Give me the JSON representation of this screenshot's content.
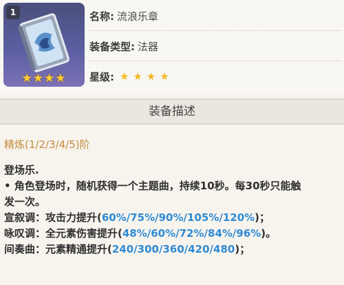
{
  "item": {
    "rarity_badge": "1",
    "stars_display": "★★★★",
    "name_label": "名称:",
    "name_value": "流浪乐章",
    "type_label": "装备类型:",
    "type_value": "法器",
    "level_label": "星级:",
    "level_value": "★★★★"
  },
  "section": {
    "title": "装备描述"
  },
  "refine": {
    "label": "精炼(1/2/3/4/5)阶"
  },
  "description": {
    "title": "登场乐.",
    "bullet_line1": "• 角色登场时，随机获得一个主题曲，持续10秒。每30秒只能触",
    "bullet_line2": "发一次。",
    "line1_prefix": "宣叙调：攻击力提升(",
    "line1_values": "60%/75%/90%/105%/120%",
    "line1_suffix": ")；",
    "line2_prefix": "咏叹调：全元素伤害提升(",
    "line2_values": "48%/60%/72%/84%/96%",
    "line2_suffix": ")。",
    "line3_prefix": "间奏曲：元素精通提升(",
    "line3_values": "240/300/360/420/480",
    "line3_suffix": ")；"
  },
  "colors": {
    "highlight": "#2f8ad4",
    "refine": "#c38a3b",
    "star": "#f2b81f"
  }
}
